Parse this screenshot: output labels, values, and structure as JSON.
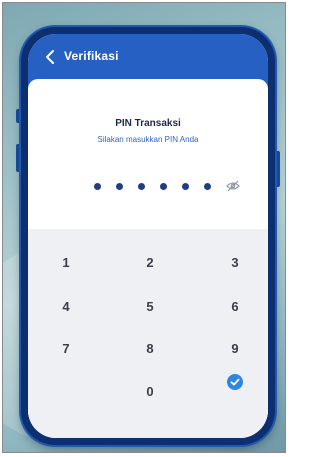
{
  "header": {
    "title": "Verifikasi",
    "back_icon": "arrow-left-icon"
  },
  "pin": {
    "title": "PIN Transaksi",
    "subtitle": "Silakan masukkan PIN Anda",
    "entered_digits": 6,
    "visibility_icon": "eye-off-icon"
  },
  "keypad": {
    "keys": [
      "1",
      "2",
      "3",
      "4",
      "5",
      "6",
      "7",
      "8",
      "9",
      "0"
    ],
    "confirm_icon": "check-circle-icon"
  },
  "colors": {
    "app_bar": "#2760c3",
    "phone_body": "#0d2f70",
    "dot": "#1e3f86",
    "confirm": "#2f86e0",
    "keypad_bg": "#eef0f4"
  }
}
